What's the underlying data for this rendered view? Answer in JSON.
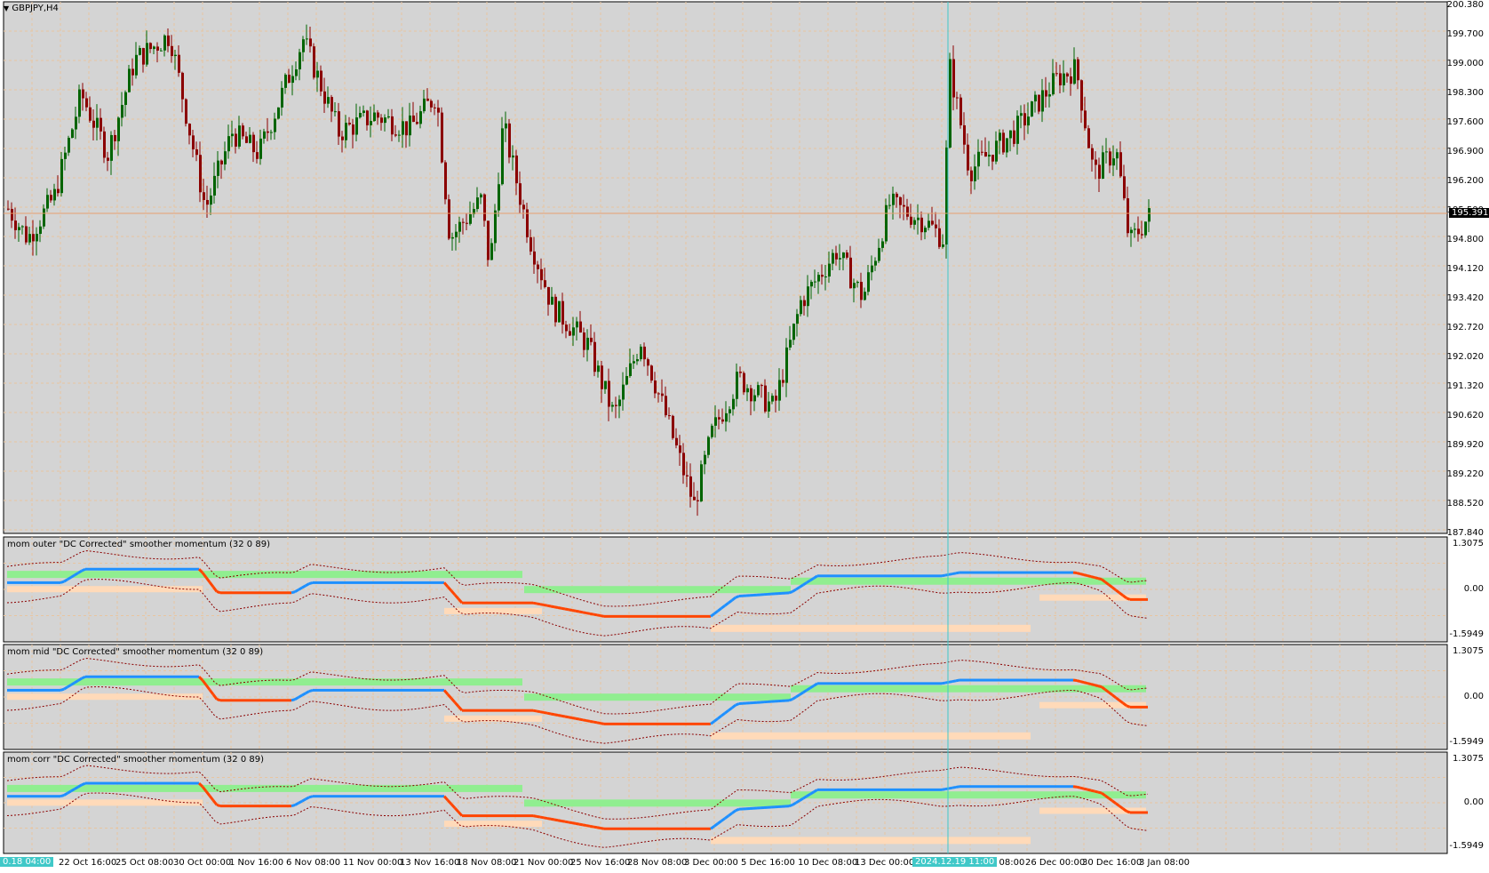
{
  "chart": {
    "symbol_label": "GBPJPY,H4",
    "current_price": "195.391",
    "crosshair_time_label": "2024.12.19 11:00",
    "left_time_label": "0.18 04:00",
    "price_axis": [
      "200.380",
      "199.700",
      "199.000",
      "198.300",
      "197.600",
      "196.900",
      "196.200",
      "195.500",
      "194.800",
      "194.120",
      "193.420",
      "192.720",
      "192.020",
      "191.320",
      "190.620",
      "189.920",
      "189.220",
      "188.520",
      "187.840"
    ],
    "time_axis": [
      "4",
      "22 Oct 16:00",
      "25 Oct 08:00",
      "30 Oct 00:00",
      "1 Nov 16:00",
      "6 Nov 08:00",
      "11 Nov 00:00",
      "13 Nov 16:00",
      "18 Nov 08:00",
      "21 Nov 00:00",
      "25 Nov 16:00",
      "28 Nov 08:00",
      "3 Dec 00:00",
      "5 Dec 16:00",
      "10 Dec 08:00",
      "13 Dec 00:00",
      "Dec 08:00",
      "26 Dec 00:00",
      "30 Dec 16:00",
      "3 Jan 08:00"
    ],
    "colors": {
      "bull": "#006400",
      "bear": "#8b0000",
      "grid": "#e8c5a0",
      "bg": "#d4d4d4",
      "up_line": "#1e90ff",
      "down_line": "#ff4500",
      "neutral_line": "#a9a9a9",
      "up_band": "#90ee90",
      "down_band": "#ffdab9"
    }
  },
  "indicators": [
    {
      "title": "mom outer \"DC Corrected\" smoother momentum (32 0 89)",
      "axis": [
        "1.3075",
        "0.00",
        "-1.5949"
      ]
    },
    {
      "title": "mom mid \"DC Corrected\" smoother momentum (32 0 89)",
      "axis": [
        "1.3075",
        "0.00",
        "-1.5949"
      ]
    },
    {
      "title": "mom corr \"DC Corrected\" smoother momentum (32 0 89)",
      "axis": [
        "1.3075",
        "0.00",
        "-1.5949"
      ]
    }
  ]
}
